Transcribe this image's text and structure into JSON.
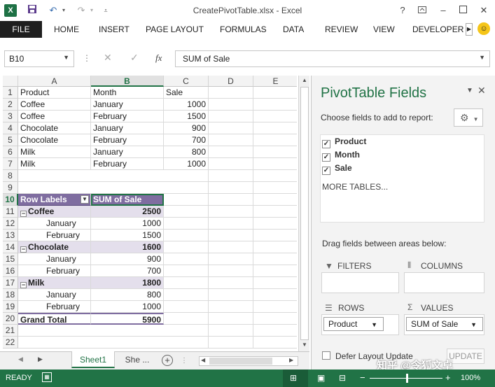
{
  "window": {
    "title": "CreatePivotTable.xlsx - Excel",
    "help": "?"
  },
  "ribbon": {
    "file": "FILE",
    "tabs": [
      "HOME",
      "INSERT",
      "PAGE LAYOUT",
      "FORMULAS",
      "DATA",
      "REVIEW",
      "VIEW",
      "DEVELOPER"
    ]
  },
  "formula_bar": {
    "name_box": "B10",
    "fx": "fx",
    "content": "SUM of Sale"
  },
  "grid": {
    "columns": [
      "A",
      "B",
      "C",
      "D",
      "E"
    ],
    "rows": [
      "1",
      "2",
      "3",
      "4",
      "5",
      "6",
      "7",
      "8",
      "9",
      "10",
      "11",
      "12",
      "13",
      "14",
      "15",
      "16",
      "17",
      "18",
      "19",
      "20",
      "21",
      "22"
    ],
    "source_header": [
      "Product",
      "Month",
      "Sale"
    ],
    "source_rows": [
      [
        "Coffee",
        "January",
        "1000"
      ],
      [
        "Coffee",
        "February",
        "1500"
      ],
      [
        "Chocolate",
        "January",
        "900"
      ],
      [
        "Chocolate",
        "February",
        "700"
      ],
      [
        "Milk",
        "January",
        "800"
      ],
      [
        "Milk",
        "February",
        "1000"
      ]
    ],
    "pivot": {
      "row_labels": "Row Labels",
      "value_header": "SUM of Sale",
      "groups": [
        {
          "name": "Coffee",
          "total": "2500",
          "items": [
            [
              "January",
              "1000"
            ],
            [
              "February",
              "1500"
            ]
          ]
        },
        {
          "name": "Chocolate",
          "total": "1600",
          "items": [
            [
              "January",
              "900"
            ],
            [
              "February",
              "700"
            ]
          ]
        },
        {
          "name": "Milk",
          "total": "1800",
          "items": [
            [
              "January",
              "800"
            ],
            [
              "February",
              "1000"
            ]
          ]
        }
      ],
      "grand_total_label": "Grand Total",
      "grand_total": "5900"
    }
  },
  "sheets": {
    "active": "Sheet1",
    "other": "She ...",
    "add": "+"
  },
  "pane": {
    "title": "PivotTable Fields",
    "choose": "Choose fields to add to report:",
    "fields": [
      "Product",
      "Month",
      "Sale"
    ],
    "more_tables": "MORE TABLES...",
    "drag": "Drag fields between areas below:",
    "filters": "FILTERS",
    "columns": "COLUMNS",
    "rows": "ROWS",
    "values": "VALUES",
    "rows_field": "Product",
    "values_field": "SUM of Sale",
    "defer": "Defer Layout Update",
    "update": "UPDATE"
  },
  "status": {
    "ready": "READY",
    "zoom": "100%",
    "watermark": "知乎 @令狐文卓"
  },
  "colors": {
    "excel_green": "#217346",
    "pivot_header": "#7f6da0",
    "pivot_subtotal": "#e4dfec"
  }
}
